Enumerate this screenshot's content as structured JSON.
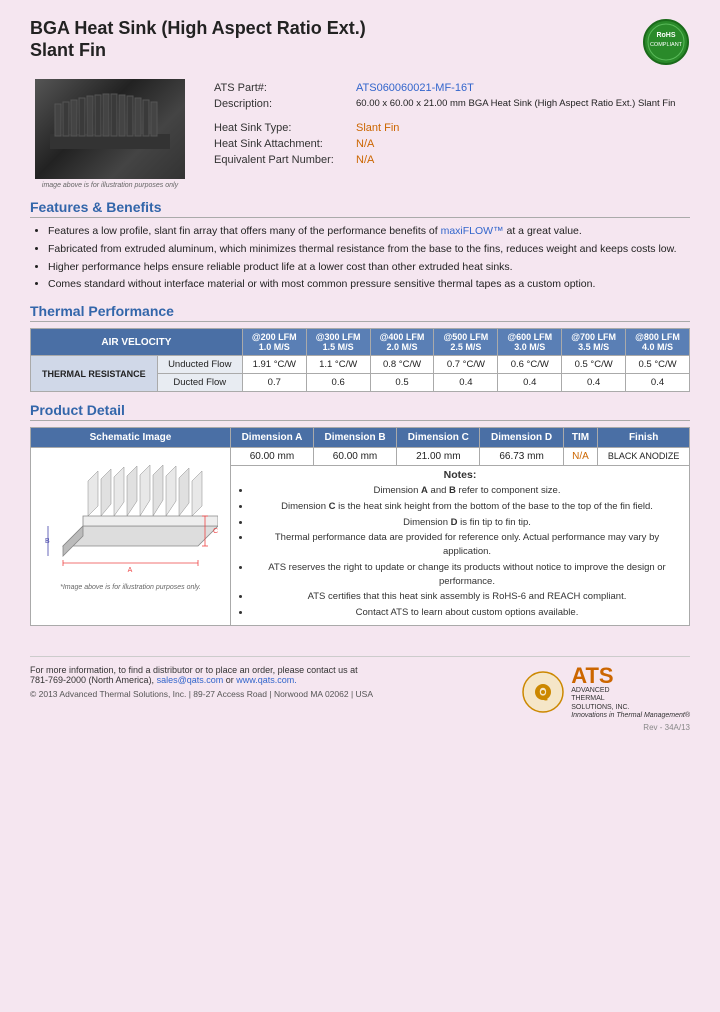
{
  "header": {
    "title_line1": "BGA Heat Sink (High Aspect Ratio Ext.)",
    "title_line2": "Slant Fin",
    "rohs_label": "RoHS Compliant"
  },
  "product": {
    "ats_part_label": "ATS Part#:",
    "ats_part_value": "ATS060060021-MF-16T",
    "description_label": "Description:",
    "description_value": "60.00 x 60.00 x 21.00 mm  BGA Heat Sink (High Aspect Ratio Ext.) Slant Fin",
    "heat_sink_type_label": "Heat Sink Type:",
    "heat_sink_type_value": "Slant Fin",
    "heat_sink_attachment_label": "Heat Sink Attachment:",
    "heat_sink_attachment_value": "N/A",
    "equivalent_part_label": "Equivalent Part Number:",
    "equivalent_part_value": "N/A",
    "image_caption": "image above is for illustration purposes only"
  },
  "features": {
    "section_title": "Features & Benefits",
    "items": [
      "Features a low profile, slant fin array that offers many of the performance benefits of maxiFLOW™ at a great value.",
      "Fabricated from extruded aluminum, which minimizes thermal resistance from the base to the fins, reduces weight and keeps costs low.",
      "Higher performance helps ensure reliable product life at a lower cost than other extruded heat sinks.",
      "Comes standard without interface material or with most common pressure sensitive thermal tapes as a custom option."
    ],
    "maxiflow_highlight": "maxiFLOW™"
  },
  "thermal_performance": {
    "section_title": "Thermal Performance",
    "air_velocity_label": "AIR VELOCITY",
    "columns": [
      {
        "lfm": "@200 LFM",
        "ms": "1.0 M/S"
      },
      {
        "lfm": "@300 LFM",
        "ms": "1.5 M/S"
      },
      {
        "lfm": "@400 LFM",
        "ms": "2.0 M/S"
      },
      {
        "lfm": "@500 LFM",
        "ms": "2.5 M/S"
      },
      {
        "lfm": "@600 LFM",
        "ms": "3.0 M/S"
      },
      {
        "lfm": "@700 LFM",
        "ms": "3.5 M/S"
      },
      {
        "lfm": "@800 LFM",
        "ms": "4.0 M/S"
      }
    ],
    "thermal_resistance_label": "THERMAL RESISTANCE",
    "rows": [
      {
        "label": "Unducted Flow",
        "values": [
          "1.91 °C/W",
          "1.1 °C/W",
          "0.8 °C/W",
          "0.7 °C/W",
          "0.6 °C/W",
          "0.5 °C/W",
          "0.5 °C/W"
        ]
      },
      {
        "label": "Ducted Flow",
        "values": [
          "0.7",
          "0.6",
          "0.5",
          "0.4",
          "0.4",
          "0.4",
          "0.4"
        ]
      }
    ]
  },
  "product_detail": {
    "section_title": "Product Detail",
    "columns": [
      "Schematic Image",
      "Dimension A",
      "Dimension B",
      "Dimension C",
      "Dimension D",
      "TIM",
      "Finish"
    ],
    "values": {
      "dim_a": "60.00 mm",
      "dim_b": "60.00 mm",
      "dim_c": "21.00 mm",
      "dim_d": "66.73 mm",
      "tim": "N/A",
      "finish": "BLACK ANODIZE"
    },
    "notes_title": "Notes:",
    "notes": [
      {
        "text": "Dimension A and B refer to component size.",
        "bold_parts": [
          "A",
          "B"
        ]
      },
      {
        "text": "Dimension C is the heat sink height from the bottom of the base to the top of the fin field.",
        "bold_parts": [
          "C"
        ]
      },
      {
        "text": "Dimension D is fin tip to fin tip.",
        "bold_parts": [
          "D"
        ]
      },
      {
        "text": "Thermal performance data are provided for reference only. Actual performance may vary by application.",
        "bold_parts": []
      },
      {
        "text": "ATS reserves the right to update or change its products without notice to improve the design or performance.",
        "bold_parts": []
      },
      {
        "text": "ATS certifies that this heat sink assembly is RoHS-6 and REACH compliant.",
        "bold_parts": []
      },
      {
        "text": "Contact ATS to learn about custom options available.",
        "bold_parts": []
      }
    ],
    "schematic_caption": "*Image above is for illustration purposes only."
  },
  "footer": {
    "contact_text": "For more information, to find a distributor or to place an order, please contact us at",
    "phone": "781-769-2000 (North America),",
    "email": "sales@qats.com",
    "email_connector": "or",
    "website": "www.qats.com.",
    "copyright": "© 2013 Advanced Thermal Solutions, Inc.  |  89-27 Access Road  |  Norwood MA  02062  |  USA",
    "ats_name": "ATS",
    "ats_fullname": "ADVANCED\nTHERMAL\nSOLUTIONS, INC.",
    "ats_tagline": "Innovations in Thermal Management®",
    "page_number": "Rev - 34A/13"
  }
}
